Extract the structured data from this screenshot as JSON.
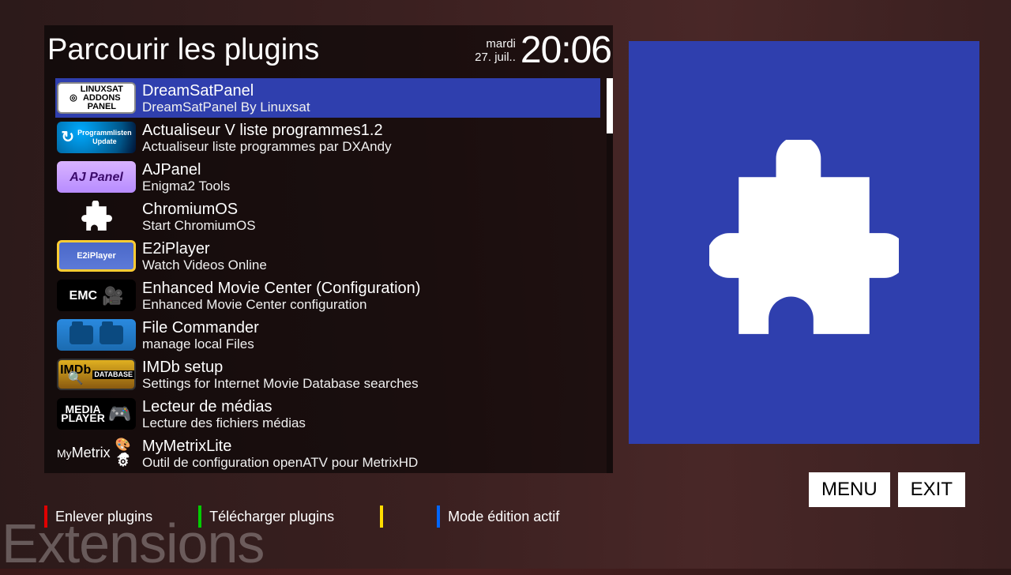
{
  "header": {
    "title": "Parcourir les plugins",
    "day": "mardi",
    "date": "27. juil..",
    "time": "20:06"
  },
  "screen_title": "Extensions",
  "plugins": [
    {
      "title": "DreamSatPanel",
      "desc": "DreamSatPanel By Linuxsat",
      "selected": true,
      "icon": "linuxsat-addons-panel"
    },
    {
      "title": "Actualiseur V liste programmes1.2",
      "desc": "Actualiseur liste programmes par DXAndy",
      "selected": false,
      "icon": "program-update"
    },
    {
      "title": "AJPanel",
      "desc": "Enigma2 Tools",
      "selected": false,
      "icon": "ajpanel"
    },
    {
      "title": "ChromiumOS",
      "desc": "Start ChromiumOS",
      "selected": false,
      "icon": "puzzle"
    },
    {
      "title": "E2iPlayer",
      "desc": "Watch Videos Online",
      "selected": false,
      "icon": "e2iplayer"
    },
    {
      "title": "Enhanced Movie Center (Configuration)",
      "desc": "Enhanced Movie Center configuration",
      "selected": false,
      "icon": "emc"
    },
    {
      "title": "File Commander",
      "desc": "manage local Files",
      "selected": false,
      "icon": "file-commander"
    },
    {
      "title": "IMDb setup",
      "desc": "Settings for Internet Movie Database searches",
      "selected": false,
      "icon": "imdb"
    },
    {
      "title": "Lecteur de médias",
      "desc": "Lecture des fichiers médias",
      "selected": false,
      "icon": "media-player"
    },
    {
      "title": "MyMetrixLite",
      "desc": "Outil de configuration openATV pour MetrixHD",
      "selected": false,
      "icon": "mymetrix"
    }
  ],
  "actions": {
    "menu": "MENU",
    "exit": "EXIT"
  },
  "legend": [
    {
      "color": "#e00000",
      "label": "Enlever plugins"
    },
    {
      "color": "#00cc00",
      "label": "Télécharger plugins"
    },
    {
      "color": "#ffdd00",
      "label": ""
    },
    {
      "color": "#0066ff",
      "label": "Mode édition actif"
    }
  ]
}
